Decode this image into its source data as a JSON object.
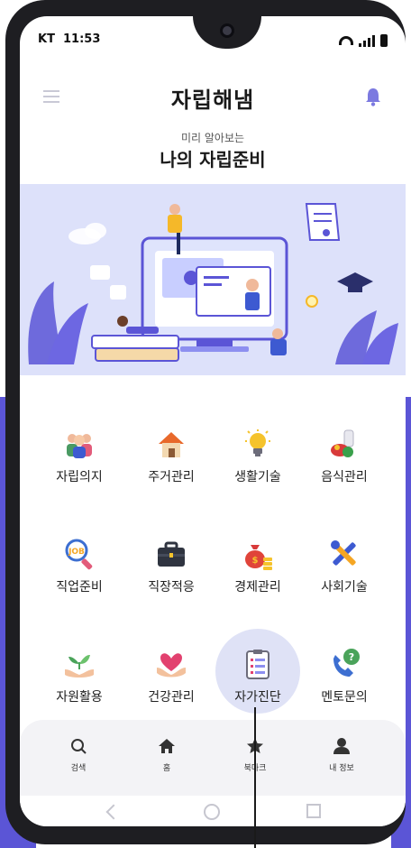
{
  "status_bar": {
    "carrier": "KT",
    "time": "11:53"
  },
  "header": {
    "app_title": "자립해냄"
  },
  "intro": {
    "subtitle": "미리 알아보는",
    "title": "나의 자립준비"
  },
  "menu": [
    {
      "label": "자립의지",
      "icon": "people-group-icon"
    },
    {
      "label": "주거관리",
      "icon": "house-icon"
    },
    {
      "label": "생활기술",
      "icon": "lightbulb-icon"
    },
    {
      "label": "음식관리",
      "icon": "food-icon"
    },
    {
      "label": "직업준비",
      "icon": "job-search-icon"
    },
    {
      "label": "직장적응",
      "icon": "briefcase-icon"
    },
    {
      "label": "경제관리",
      "icon": "money-bag-icon"
    },
    {
      "label": "사회기술",
      "icon": "tools-icon"
    },
    {
      "label": "자원활용",
      "icon": "plant-hands-icon"
    },
    {
      "label": "건강관리",
      "icon": "heart-hands-icon"
    },
    {
      "label": "자가진단",
      "icon": "checklist-icon",
      "active": true
    },
    {
      "label": "멘토문의",
      "icon": "phone-question-icon"
    }
  ],
  "tabs": [
    {
      "label": "검색",
      "icon": "search-icon"
    },
    {
      "label": "홈",
      "icon": "home-icon"
    },
    {
      "label": "북마크",
      "icon": "star-icon"
    },
    {
      "label": "내 정보",
      "icon": "person-icon"
    }
  ],
  "colors": {
    "accent": "#5b55d6",
    "banner_bg": "#dde1fa",
    "active_halo": "#dfe2f6",
    "bell": "#7c7ae0"
  }
}
